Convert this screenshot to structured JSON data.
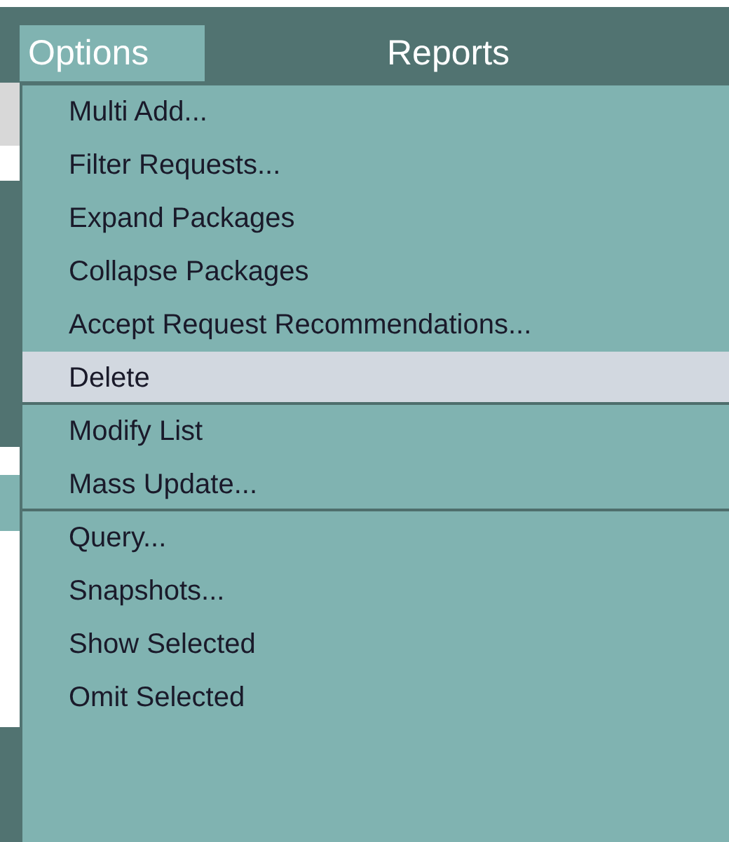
{
  "menubar": [
    {
      "label": "Options",
      "selected": true
    },
    {
      "label": "Reports",
      "selected": false
    }
  ],
  "menu": [
    {
      "label": "Multi Add...",
      "selected": false,
      "separator_after": false
    },
    {
      "label": "Filter Requests...",
      "selected": false,
      "separator_after": false
    },
    {
      "label": "Expand Packages",
      "selected": false,
      "separator_after": false
    },
    {
      "label": "Collapse Packages",
      "selected": false,
      "separator_after": false
    },
    {
      "label": "Accept Request Recommendations...",
      "selected": false,
      "separator_after": false
    },
    {
      "label": "Delete",
      "selected": true,
      "separator_after": true
    },
    {
      "label": "Modify List",
      "selected": false,
      "separator_after": false
    },
    {
      "label": "Mass Update...",
      "selected": false,
      "separator_after": true
    },
    {
      "label": "Query...",
      "selected": false,
      "separator_after": false
    },
    {
      "label": "Snapshots...",
      "selected": false,
      "separator_after": false
    },
    {
      "label": "Show Selected",
      "selected": false,
      "separator_after": false
    },
    {
      "label": "Omit Selected",
      "selected": false,
      "separator_after": false
    }
  ]
}
